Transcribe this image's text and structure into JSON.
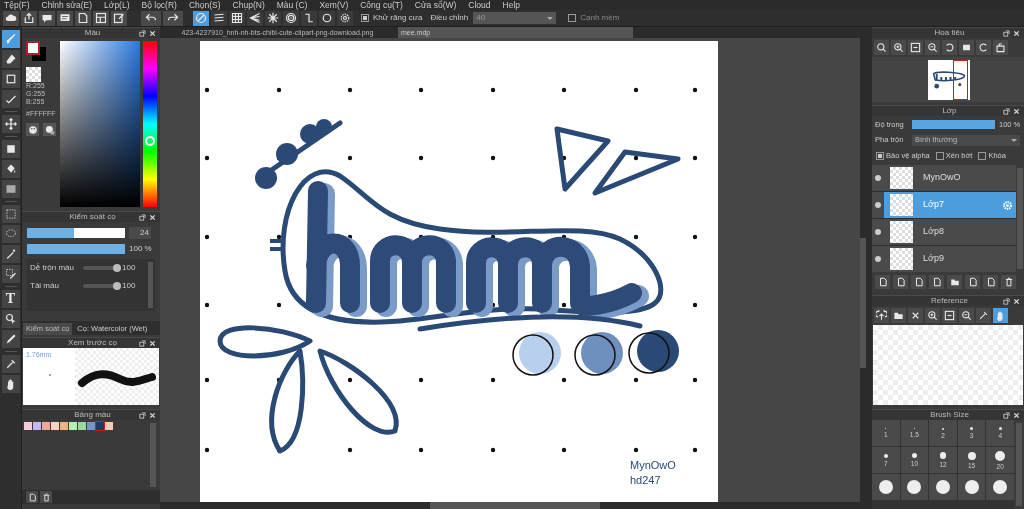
{
  "menu": [
    "Tệp(F)",
    "Chỉnh sửa(E)",
    "Lớp(L)",
    "Bộ lọc(R)",
    "Chọn(S)",
    "Chụp(N)",
    "Màu (C)",
    "Xem(V)",
    "Công cụ(T)",
    "Cửa sổ(W)",
    "Cloud",
    "Help"
  ],
  "toolbar": {
    "snap_buttons": [
      {
        "selected": true
      },
      {
        "selected": false
      },
      {
        "selected": false
      },
      {
        "selected": false
      },
      {
        "selected": false
      },
      {
        "selected": false
      },
      {
        "selected": false
      },
      {
        "selected": false
      },
      {
        "selected": false
      }
    ],
    "antialias": {
      "label": "Khử răng cưa",
      "checked": true
    },
    "correction": {
      "label": "Điều chỉnh",
      "value": "40"
    },
    "soft_edge": {
      "label": "Cạnh mềm",
      "checked": false
    }
  },
  "document_tabs": [
    {
      "label": "423-4237910_hnh-nh-bts-chibi-cute-clipart-png-download.png",
      "selected": false
    },
    {
      "label": "mee.mdp",
      "selected": true
    }
  ],
  "tools": [
    {
      "selected": true
    },
    {
      "selected": false
    },
    {
      "selected": false
    },
    {
      "selected": false
    },
    {
      "selected": false
    },
    {
      "selected": false
    },
    {
      "selected": false
    },
    {
      "selected": false
    },
    {
      "selected": false
    },
    {
      "selected": false
    },
    {
      "selected": false
    },
    {
      "selected": false
    },
    {
      "selected": false,
      "glyph": "T"
    },
    {
      "selected": false
    },
    {
      "selected": false
    },
    {
      "selected": false
    },
    {
      "selected": false
    }
  ],
  "color_panel": {
    "title": "Màu",
    "red": "R:255",
    "green": "G:255",
    "blue": "B:255",
    "hex": "#FFFFFF",
    "hue": {
      "level": 0.4
    }
  },
  "brush_control": {
    "title": "Kiểm soát cọ",
    "size": {
      "value": "24",
      "level": 0.48
    },
    "opacity": {
      "value": "100 %",
      "level": 1
    },
    "sliders": [
      {
        "label": "Dễ trộn màu",
        "value": "100",
        "level": 1
      },
      {
        "label": "Tải màu",
        "value": "100",
        "level": 1
      }
    ]
  },
  "left_tabs": [
    {
      "label": "Kiểm soát cọ",
      "selected": true
    },
    {
      "label": "Cọ: Watercolor (Wet)",
      "selected": false
    }
  ],
  "brush_preview": {
    "title": "Xem trước cọ",
    "size": "1.76mm"
  },
  "palette": {
    "title": "Bảng màu",
    "colors": [
      {
        "color": "#f4ccd8",
        "selected": false
      },
      {
        "color": "#c8b4f0",
        "selected": false
      },
      {
        "color": "#f0a898",
        "selected": false
      },
      {
        "color": "#f8d4c8",
        "selected": false
      },
      {
        "color": "#f0b47c",
        "selected": false
      },
      {
        "color": "#b4f0b4",
        "selected": false
      },
      {
        "color": "#9cd89c",
        "selected": false
      },
      {
        "color": "#7098c8",
        "selected": false
      },
      {
        "color": "#203a64",
        "selected": true
      },
      {
        "color": "#f8ccb4",
        "selected": false
      }
    ]
  },
  "navigator": {
    "title": "Hoa tiêu"
  },
  "layers": {
    "title": "Lớp",
    "opacity": {
      "label": "Độ trong",
      "value": "100 %",
      "level": 1
    },
    "blend": {
      "label": "Pha trộn",
      "value": "Bình thường"
    },
    "options": [
      {
        "label": "Bảo vệ alpha",
        "checked": true
      },
      {
        "label": "Xén bớt",
        "checked": false
      },
      {
        "label": "Khóa",
        "checked": false
      }
    ],
    "items": [
      {
        "name": "MynOwO",
        "selected": false
      },
      {
        "name": "Lớp7",
        "selected": true
      },
      {
        "name": "Lớp8",
        "selected": false
      },
      {
        "name": "Lớp9",
        "selected": false
      }
    ]
  },
  "reference": {
    "title": "Reference"
  },
  "brush_size": {
    "title": "Brush Size",
    "sizes": [
      {
        "kind": "labeled",
        "label": "1"
      },
      {
        "kind": "labeled",
        "label": "1.5"
      },
      {
        "kind": "labeled",
        "label": "2"
      },
      {
        "kind": "labeled",
        "label": "3"
      },
      {
        "kind": "labeled",
        "label": "4"
      },
      {
        "kind": "labeled",
        "label": "7"
      },
      {
        "kind": "labeled",
        "label": "10"
      },
      {
        "kind": "labeled",
        "label": "12"
      },
      {
        "kind": "labeled",
        "label": "15"
      },
      {
        "kind": "labeled",
        "label": "20"
      },
      {
        "kind": "unlabeled"
      },
      {
        "kind": "unlabeled"
      },
      {
        "kind": "unlabeled"
      },
      {
        "kind": "unlabeled"
      },
      {
        "kind": "unlabeled"
      }
    ]
  },
  "canvas": {
    "signature": [
      "MynOwO",
      "hd247"
    ]
  }
}
